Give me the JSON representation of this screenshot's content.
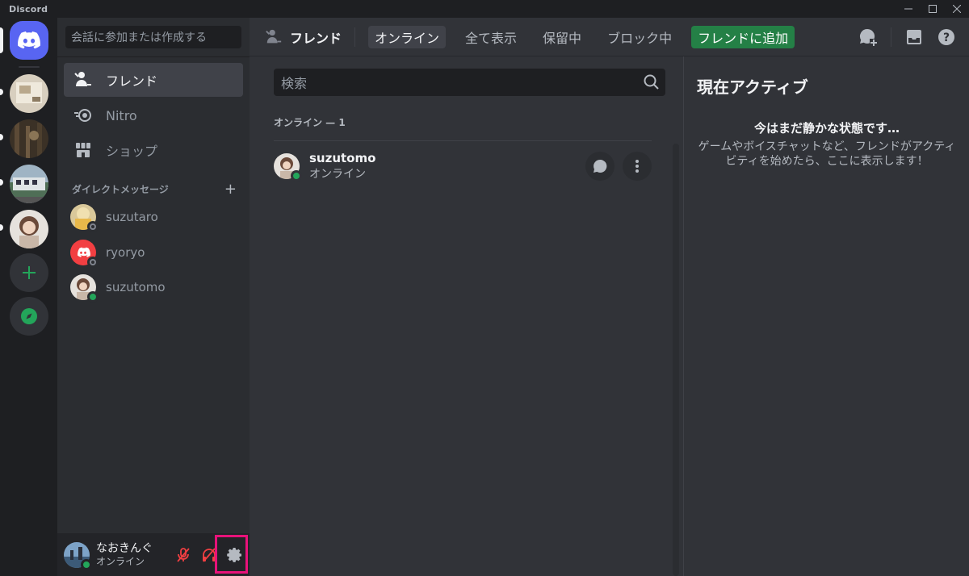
{
  "window": {
    "app_name": "Discord",
    "controls": [
      "minimize",
      "maximize",
      "close"
    ]
  },
  "servers": [
    {
      "name": "home",
      "icon": "discord-logo-icon"
    },
    {
      "name": "server-1"
    },
    {
      "name": "server-2"
    },
    {
      "name": "server-3"
    },
    {
      "name": "server-4"
    },
    {
      "name": "add-server",
      "icon": "plus-icon"
    },
    {
      "name": "explore",
      "icon": "compass-icon"
    }
  ],
  "sidebar": {
    "search_placeholder": "会話に参加または作成する",
    "nav": [
      {
        "label": "フレンド",
        "icon": "friends-icon",
        "active": true
      },
      {
        "label": "Nitro",
        "icon": "nitro-icon"
      },
      {
        "label": "ショップ",
        "icon": "shop-icon"
      }
    ],
    "dm_header": "ダイレクトメッセージ",
    "dm_add": "+",
    "dms": [
      {
        "name": "suzutaro",
        "status": "offline"
      },
      {
        "name": "ryoryo",
        "status": "offline"
      },
      {
        "name": "suzutomo",
        "status": "online"
      }
    ]
  },
  "user_panel": {
    "name": "なおきんぐ",
    "status": "オンライン",
    "buttons": [
      "mic-muted-icon",
      "headphones-muted-icon",
      "gear-icon"
    ]
  },
  "header": {
    "title": "フレンド",
    "tabs": [
      {
        "label": "オンライン",
        "active": true
      },
      {
        "label": "全て表示"
      },
      {
        "label": "保留中"
      },
      {
        "label": "ブロック中"
      }
    ],
    "add_friend": "フレンドに追加",
    "icons": [
      "new-group-dm-icon",
      "inbox-icon",
      "help-icon"
    ]
  },
  "friends": {
    "search_placeholder": "検索",
    "section_title": "オンライン — 1",
    "list": [
      {
        "name": "suzutomo",
        "status": "オンライン"
      }
    ]
  },
  "active_now": {
    "title": "現在アクティブ",
    "empty_heading": "今はまだ静かな状態です…",
    "empty_text": "ゲームやボイスチャットなど、フレンドがアクティビティを始めたら、ここに表示します！"
  },
  "colors": {
    "accent": "#5865f2",
    "online": "#23a55a",
    "add_friend_green": "#248046",
    "muted_red": "#f23f42",
    "highlight": "#e8127a"
  }
}
